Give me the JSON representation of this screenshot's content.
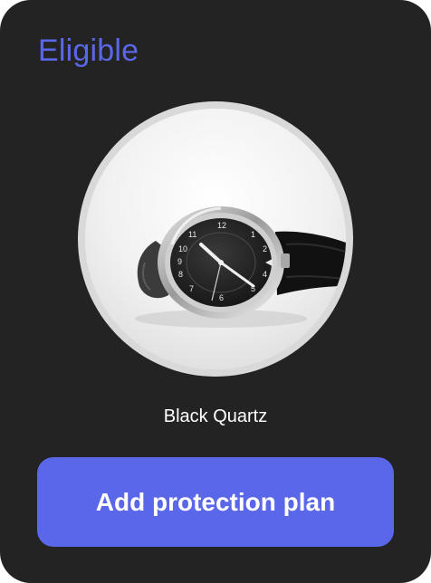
{
  "card": {
    "status_label": "Eligible",
    "product_name": "Black Quartz",
    "product_image": {
      "icon": "wristwatch-icon",
      "alt": "Black Quartz"
    },
    "cta_label": "Add protection plan",
    "colors": {
      "card_background": "#232323",
      "accent": "#5a67e8",
      "text": "#ffffff",
      "image_ring": "#d9d9d9"
    }
  }
}
